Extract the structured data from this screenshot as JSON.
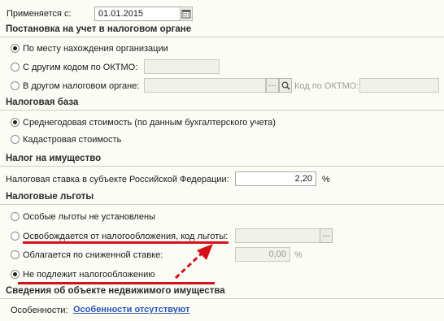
{
  "applies_from": {
    "label": "Применяется с:",
    "value": "01.01.2015"
  },
  "registration": {
    "title": "Постановка на учет в налоговом органе",
    "options": [
      {
        "label": "По месту нахождения организации",
        "selected": true
      },
      {
        "label": "С другим кодом по ОКТМО:",
        "selected": false
      },
      {
        "label": "В другом налоговом органе:",
        "selected": false
      }
    ],
    "oktmo_label": "Код по ОКТМО:"
  },
  "tax_base": {
    "title": "Налоговая база",
    "options": [
      {
        "label": "Среднегодовая стоимость (по данным бухгалтерского учета)",
        "selected": true
      },
      {
        "label": "Кадастровая стоимость",
        "selected": false
      }
    ]
  },
  "property_tax": {
    "title": "Налог на имущество",
    "rate_label": "Налоговая ставка в субъекте Российской Федерации:",
    "rate_value": "2,20",
    "rate_unit": "%"
  },
  "benefits": {
    "title": "Налоговые льготы",
    "options": [
      {
        "label": "Особые льготы не установлены",
        "selected": false
      },
      {
        "label": "Освобождается от налогообложения, код льготы:",
        "selected": false
      },
      {
        "label": "Облагается по сниженной ставке:",
        "selected": false
      },
      {
        "label": "Не подлежит налогообложению",
        "selected": true
      }
    ],
    "reduced_rate_value": "0,00",
    "reduced_rate_unit": "%"
  },
  "realty": {
    "title": "Сведения об объекте недвижимого имущества",
    "features_label": "Особенности:",
    "features_link": "Особенности отсутствуют"
  },
  "colors": {
    "annotation": "#d8101a",
    "link": "#2c56b3"
  },
  "icons": [
    "calendar-icon",
    "ellipsis-icon",
    "search-icon"
  ]
}
